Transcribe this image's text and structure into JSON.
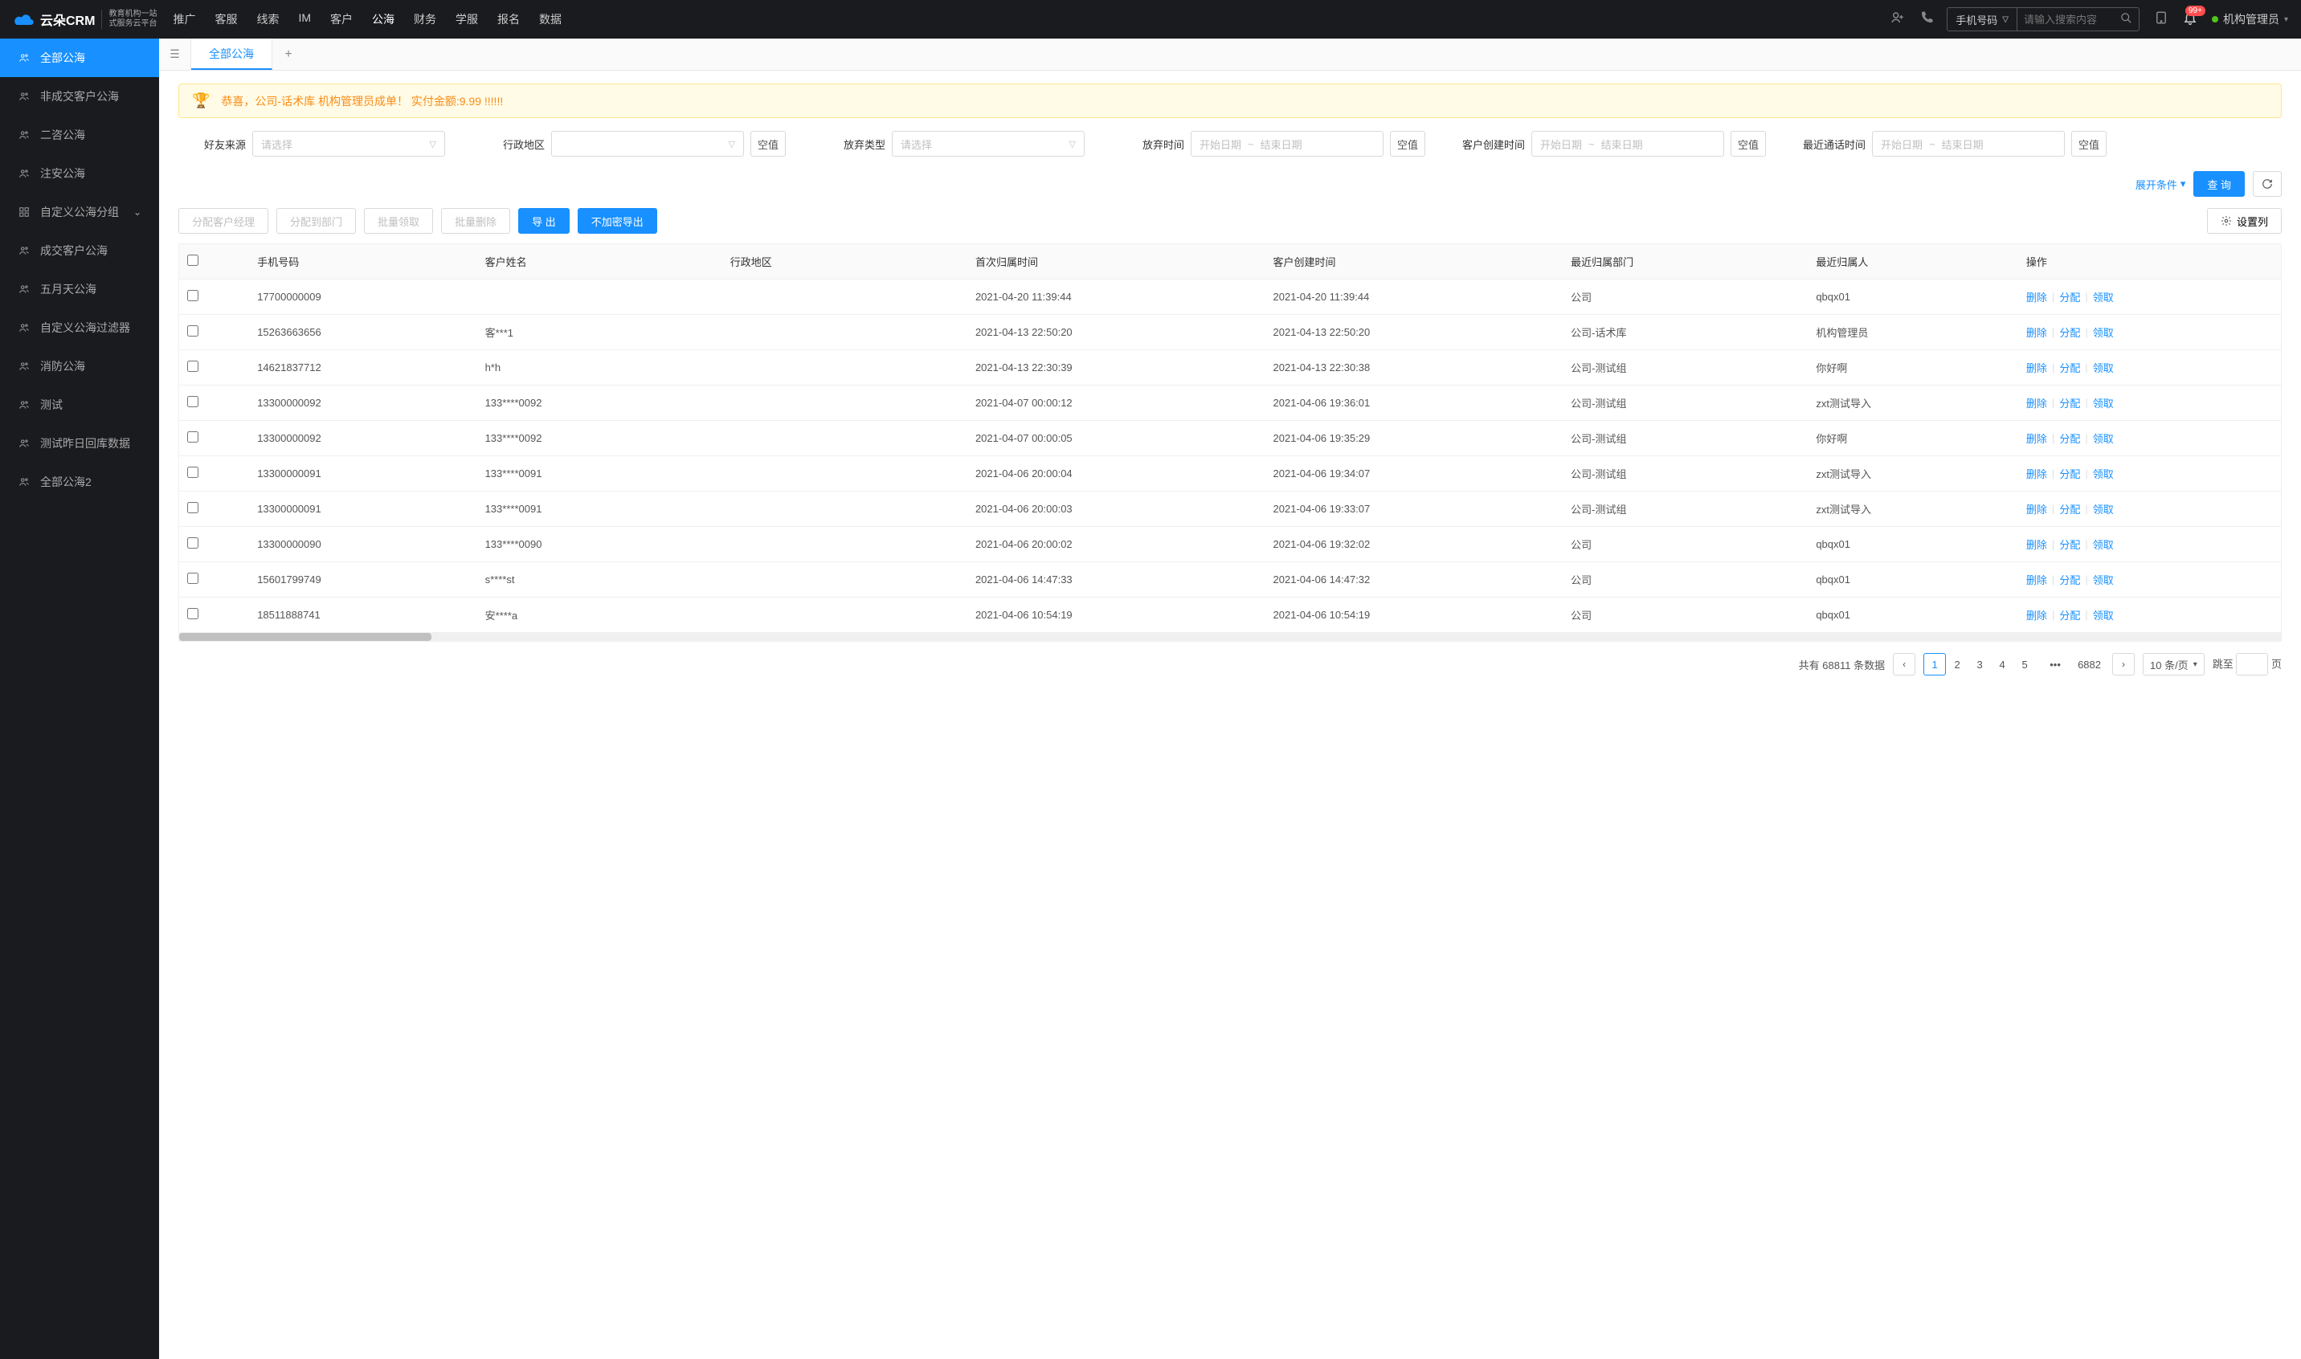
{
  "header": {
    "logo_main": "云朵CRM",
    "logo_sub_url": "www.yunduocrm.com",
    "logo_sub1": "教育机构一站",
    "logo_sub2": "式服务云平台",
    "nav": [
      "推广",
      "客服",
      "线索",
      "IM",
      "客户",
      "公海",
      "财务",
      "学服",
      "报名",
      "数据"
    ],
    "nav_active": 5,
    "search_type": "手机号码",
    "search_placeholder": "请输入搜索内容",
    "badge": "99+",
    "user": "机构管理员"
  },
  "sidebar": {
    "items": [
      {
        "icon": "users",
        "label": "全部公海",
        "active": true
      },
      {
        "icon": "users",
        "label": "非成交客户公海"
      },
      {
        "icon": "users",
        "label": "二咨公海"
      },
      {
        "icon": "users",
        "label": "注安公海"
      },
      {
        "icon": "grid",
        "label": "自定义公海分组",
        "chevron": true
      },
      {
        "icon": "users",
        "label": "成交客户公海"
      },
      {
        "icon": "users",
        "label": "五月天公海"
      },
      {
        "icon": "users",
        "label": "自定义公海过滤器"
      },
      {
        "icon": "users",
        "label": "消防公海"
      },
      {
        "icon": "users",
        "label": "测试"
      },
      {
        "icon": "users",
        "label": "测试昨日回库数据"
      },
      {
        "icon": "users",
        "label": "全部公海2"
      }
    ]
  },
  "tabs": {
    "active": "全部公海"
  },
  "alert": "恭喜，公司-话术库  机构管理员成单！  实付金额:9.99 !!!!!!",
  "filters": {
    "source_label": "好友来源",
    "region_label": "行政地区",
    "abandon_type_label": "放弃类型",
    "abandon_time_label": "放弃时间",
    "create_time_label": "客户创建时间",
    "recent_call_label": "最近通话时间",
    "placeholder_select": "请选择",
    "placeholder_start": "开始日期",
    "placeholder_end": "结束日期",
    "null_btn": "空值",
    "expand": "展开条件",
    "query": "查 询"
  },
  "actions": {
    "assign_mgr": "分配客户经理",
    "assign_dept": "分配到部门",
    "batch_claim": "批量领取",
    "batch_delete": "批量删除",
    "export": "导 出",
    "export_plain": "不加密导出",
    "settings": "设置列"
  },
  "table": {
    "columns": [
      "手机号码",
      "客户姓名",
      "行政地区",
      "首次归属时间",
      "客户创建时间",
      "最近归属部门",
      "最近归属人",
      "操作"
    ],
    "ops": {
      "delete": "删除",
      "assign": "分配",
      "claim": "领取"
    },
    "rows": [
      {
        "phone": "17700000009",
        "name": "",
        "region": "",
        "first_time": "2021-04-20 11:39:44",
        "create_time": "2021-04-20 11:39:44",
        "dept": "公司",
        "owner": "qbqx01"
      },
      {
        "phone": "15263663656",
        "name": "客***1",
        "region": "",
        "first_time": "2021-04-13 22:50:20",
        "create_time": "2021-04-13 22:50:20",
        "dept": "公司-话术库",
        "owner": "机构管理员"
      },
      {
        "phone": "14621837712",
        "name": "h*h",
        "region": "",
        "first_time": "2021-04-13 22:30:39",
        "create_time": "2021-04-13 22:30:38",
        "dept": "公司-测试组",
        "owner": "你好啊"
      },
      {
        "phone": "13300000092",
        "name": "133****0092",
        "region": "",
        "first_time": "2021-04-07 00:00:12",
        "create_time": "2021-04-06 19:36:01",
        "dept": "公司-测试组",
        "owner": "zxt测试导入"
      },
      {
        "phone": "13300000092",
        "name": "133****0092",
        "region": "",
        "first_time": "2021-04-07 00:00:05",
        "create_time": "2021-04-06 19:35:29",
        "dept": "公司-测试组",
        "owner": "你好啊"
      },
      {
        "phone": "13300000091",
        "name": "133****0091",
        "region": "",
        "first_time": "2021-04-06 20:00:04",
        "create_time": "2021-04-06 19:34:07",
        "dept": "公司-测试组",
        "owner": "zxt测试导入"
      },
      {
        "phone": "13300000091",
        "name": "133****0091",
        "region": "",
        "first_time": "2021-04-06 20:00:03",
        "create_time": "2021-04-06 19:33:07",
        "dept": "公司-测试组",
        "owner": "zxt测试导入"
      },
      {
        "phone": "13300000090",
        "name": "133****0090",
        "region": "",
        "first_time": "2021-04-06 20:00:02",
        "create_time": "2021-04-06 19:32:02",
        "dept": "公司",
        "owner": "qbqx01"
      },
      {
        "phone": "15601799749",
        "name": "s****st",
        "region": "",
        "first_time": "2021-04-06 14:47:33",
        "create_time": "2021-04-06 14:47:32",
        "dept": "公司",
        "owner": "qbqx01"
      },
      {
        "phone": "18511888741",
        "name": "安****a",
        "region": "",
        "first_time": "2021-04-06 10:54:19",
        "create_time": "2021-04-06 10:54:19",
        "dept": "公司",
        "owner": "qbqx01"
      }
    ]
  },
  "pagination": {
    "total_prefix": "共有",
    "total": "68811",
    "total_suffix": "条数据",
    "pages": [
      "1",
      "2",
      "3",
      "4",
      "5"
    ],
    "ellipsis": "•••",
    "last": "6882",
    "size": "10 条/页",
    "jump_label": "跳至",
    "jump_suffix": "页"
  }
}
